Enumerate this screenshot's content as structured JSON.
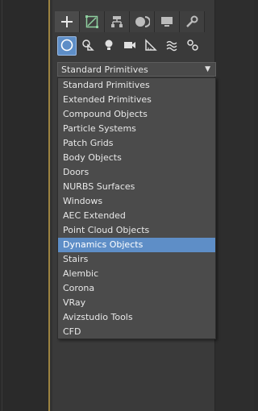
{
  "command_panel": {
    "tabs": [
      {
        "icon": "plus-icon",
        "name": "create"
      },
      {
        "icon": "modify-icon",
        "name": "modify"
      },
      {
        "icon": "hierarchy-icon",
        "name": "hierarchy"
      },
      {
        "icon": "motion-icon",
        "name": "motion"
      },
      {
        "icon": "display-icon",
        "name": "display"
      },
      {
        "icon": "wrench-icon",
        "name": "utilities"
      }
    ],
    "active_tab": "create",
    "subcategories": [
      {
        "icon": "geometry-icon",
        "name": "geometry"
      },
      {
        "icon": "shapes-icon",
        "name": "shapes"
      },
      {
        "icon": "lights-icon",
        "name": "lights"
      },
      {
        "icon": "cameras-icon",
        "name": "cameras"
      },
      {
        "icon": "helpers-icon",
        "name": "helpers"
      },
      {
        "icon": "spacewarps-icon",
        "name": "space-warps"
      },
      {
        "icon": "systems-icon",
        "name": "systems"
      }
    ],
    "active_subcategory": "geometry",
    "dropdown": {
      "selected_value": "Standard Primitives",
      "options": [
        "Standard Primitives",
        "Extended Primitives",
        "Compound Objects",
        "Particle Systems",
        "Patch Grids",
        "Body Objects",
        "Doors",
        "NURBS Surfaces",
        "Windows",
        "AEC Extended",
        "Point Cloud Objects",
        "Dynamics Objects",
        "Stairs",
        "Alembic",
        "Corona",
        "VRay",
        "Avizstudio Tools",
        "CFD"
      ],
      "highlighted_option": "Dynamics Objects"
    }
  },
  "colors": {
    "accent": "#5e8ec7",
    "viewport_border": "#9c8340",
    "panel_bg": "#3a3a3a",
    "dropdown_bg": "#4b4b4b"
  }
}
